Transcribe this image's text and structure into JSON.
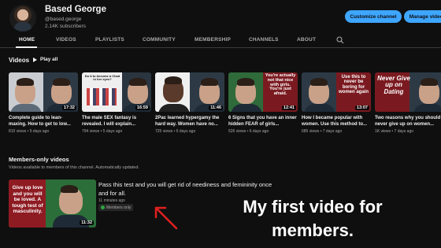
{
  "channel": {
    "name": "Based George",
    "handle": "@based.george",
    "subscribers": "2.14K subscribers",
    "customize_label": "Customize channel",
    "manage_label": "Manage videos"
  },
  "tabs": [
    "HOME",
    "VIDEOS",
    "PLAYLISTS",
    "COMMUNITY",
    "MEMBERSHIP",
    "CHANNELS",
    "ABOUT"
  ],
  "videos_section": {
    "title": "Videos",
    "play_all": "Play all"
  },
  "videos": [
    {
      "title": "Complete guide to lean-maxing. How to get to low...",
      "views": "810 views",
      "age": "5 days ago",
      "duration": "17:32",
      "thumb_text": ""
    },
    {
      "title": "The male SEX fantasy is revealed. I will explain...",
      "views": "794 views",
      "age": "5 days ago",
      "duration": "16:59",
      "thumb_text": "Do it to become a Chad in her eyes?"
    },
    {
      "title": "2Pac learned hypergamy the hard way. Women have no...",
      "views": "725 views",
      "age": "6 days ago",
      "duration": "11:46",
      "thumb_text": ""
    },
    {
      "title": "6 Signs that you have an inner hidden FEAR of girls...",
      "views": "526 views",
      "age": "6 days ago",
      "duration": "12:41",
      "thumb_text": "You're actually not that nice with girls. You're just afraid."
    },
    {
      "title": "How I became popular with women. Use this method to...",
      "views": "685 views",
      "age": "7 days ago",
      "duration": "13:07",
      "thumb_text": "Use this to never be boring for women again"
    },
    {
      "title": "Two reasons why you should never give up on women...",
      "views": "1K views",
      "age": "7 days ago",
      "duration": "",
      "thumb_text": "Never Give up on Dating"
    }
  ],
  "members_section": {
    "title": "Members-only videos",
    "description": "Videos available to members of this channel. Automatically updated."
  },
  "members_video": {
    "title": "Pass this test and you will get rid of neediness and femininity once and for all.",
    "age": "11 minutes ago",
    "badge": "Members only",
    "duration": "11:32",
    "thumb_text": "Give up love and you will be loved. A tough test of masculinity."
  },
  "overlay_caption": "My first video for members.",
  "colors": {
    "accent": "#3ea6ff",
    "background": "#0f0f0f",
    "arrow": "#e02020",
    "badge": "#2ba640"
  },
  "icons": [
    "search-icon",
    "play-icon",
    "members-icon",
    "arrow-icon"
  ]
}
